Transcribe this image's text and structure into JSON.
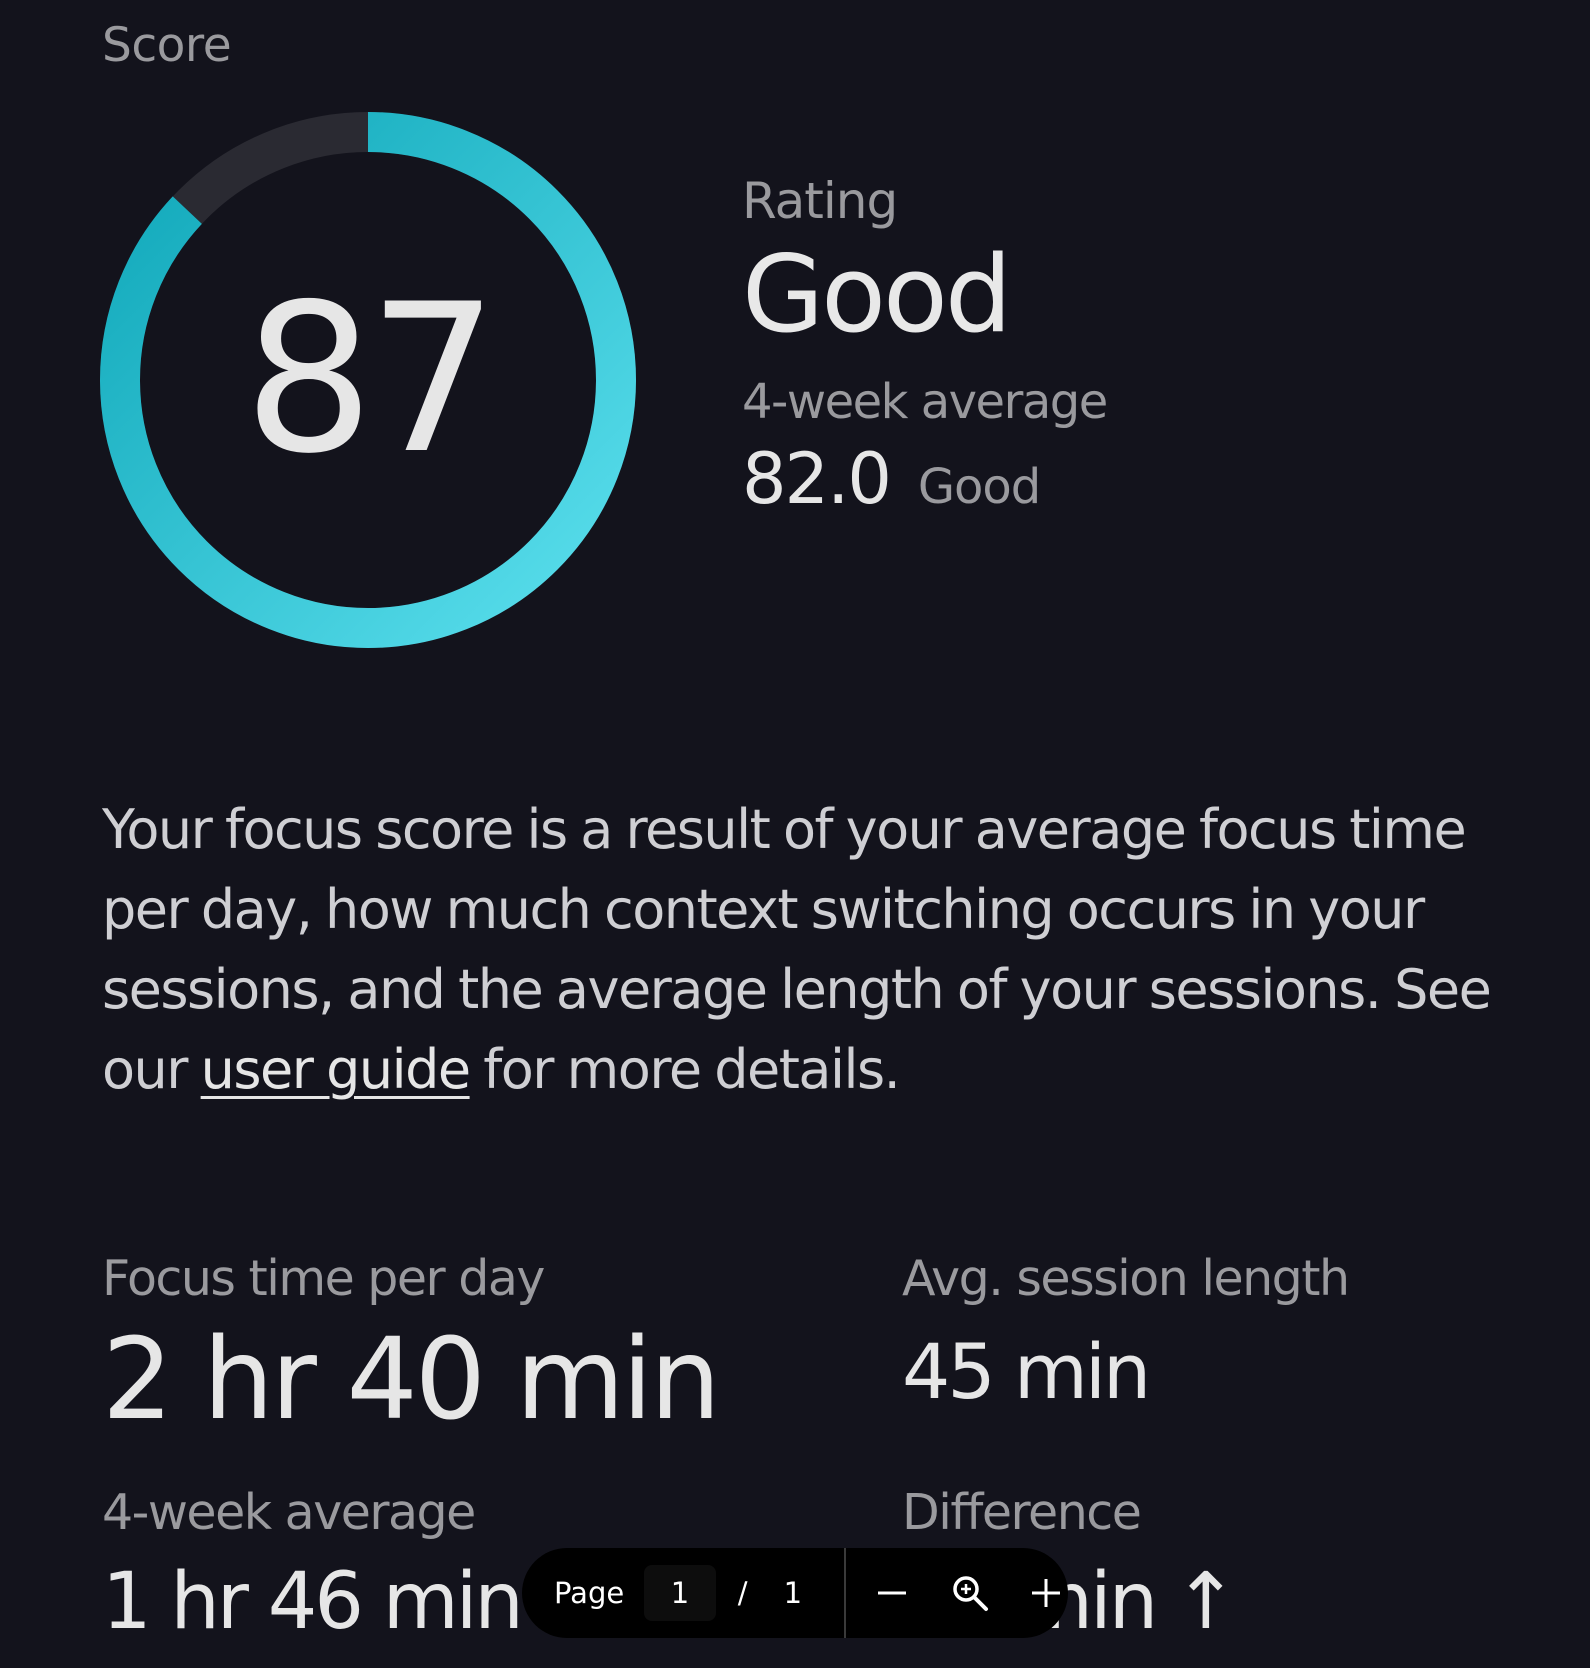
{
  "score_section": {
    "label": "Score",
    "score": "87",
    "score_fraction": 0.87,
    "ring_colors": {
      "start": "#5ce0ee",
      "end": "#0ea6b8",
      "track": "#2a2a32"
    }
  },
  "rating": {
    "label": "Rating",
    "value": "Good",
    "avg_label": "4-week average",
    "avg_value": "82.0",
    "avg_rating": "Good"
  },
  "description": {
    "text_before": "Your focus score is a result of your average focus time per day, how much context switching occurs in your sessions, and the average length of your sessions. See our ",
    "link_text": "user guide",
    "text_after": " for more details."
  },
  "metrics": {
    "focus_time": {
      "label": "Focus time per day",
      "value": "2 hr 40 min"
    },
    "session_length": {
      "label": "Avg. session length",
      "value": "45 min"
    },
    "four_week": {
      "label": "4-week average",
      "value": "1 hr 46 min"
    },
    "difference": {
      "label": "Difference",
      "value": "53 min",
      "arrow": "↑"
    }
  },
  "pdf_toolbar": {
    "page_label": "Page",
    "current_page": "1",
    "separator": "/",
    "total_pages": "1",
    "icons": [
      "minus-icon",
      "zoom-fit-icon",
      "plus-icon"
    ]
  }
}
